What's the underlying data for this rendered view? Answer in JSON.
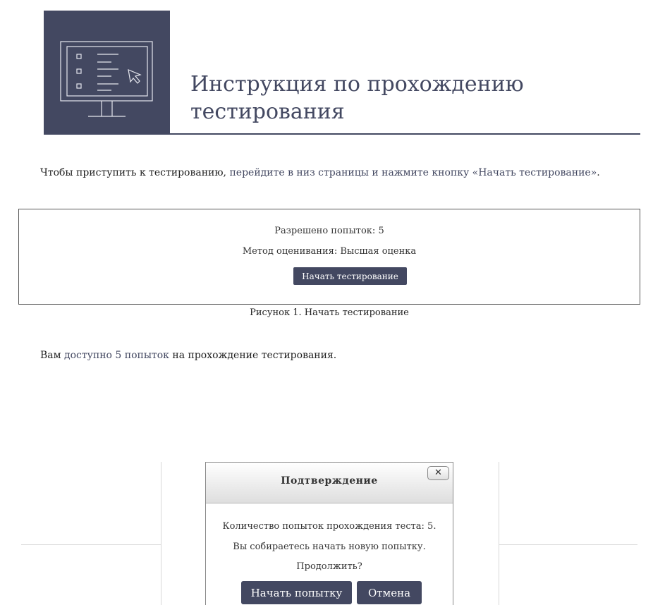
{
  "header": {
    "title_line1": "Инструкция по прохождению",
    "title_line2": "тестирования",
    "icon": "monitor-checklist-icon",
    "colors": {
      "accent": "#434861",
      "icon_stroke": "#e6e7ee"
    }
  },
  "intro": {
    "text_prefix": "Чтобы приступить к тестированию, ",
    "text_highlight": "перейдите в низ страницы и нажмите кнопку «Начать тестирование»",
    "text_suffix": "."
  },
  "figure1": {
    "allowed_attempts": "Разрешено попыток: 5",
    "grading_method": "Метод оценивания: Высшая оценка",
    "start_button": "Начать тестирование",
    "caption": "Рисунок 1. Начать тестирование"
  },
  "attempts_note": {
    "prefix": "Вам ",
    "highlight": "доступно 5 попыток",
    "suffix": " на прохождение тестирования."
  },
  "dialog": {
    "title": "Подтверждение",
    "close_glyph": "✕",
    "line1": "Количество попыток прохождения теста: 5.",
    "line2": "Вы собираетесь начать новую попытку.",
    "line3": "Продолжить?",
    "confirm_button": "Начать попытку",
    "cancel_button": "Отмена"
  }
}
